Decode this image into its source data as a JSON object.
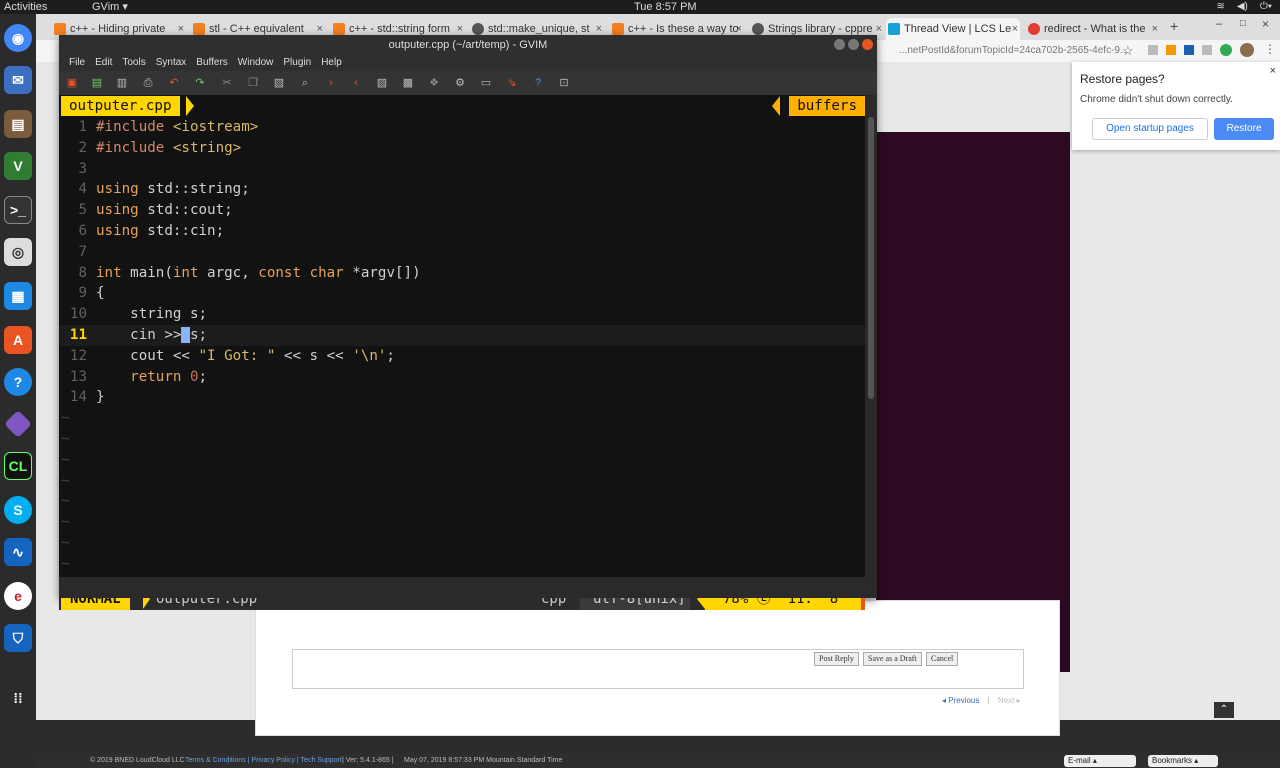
{
  "topbar": {
    "activities": "Activities",
    "app_name": "GVim ▾",
    "clock": "Tue  8:57 PM"
  },
  "chrome": {
    "tabs": [
      {
        "label": "c++ - Hiding private",
        "fav_color": "#f48024"
      },
      {
        "label": "stl - C++ equivalent",
        "fav_color": "#f48024"
      },
      {
        "label": "c++ - std::string form",
        "fav_color": "#f48024"
      },
      {
        "label": "std::make_unique, st",
        "fav_color": "#555555"
      },
      {
        "label": "c++ - Is these a way to",
        "fav_color": "#f48024"
      },
      {
        "label": "Strings library - cppre",
        "fav_color": "#555555"
      },
      {
        "label": "Thread View | LCS Le",
        "fav_color": "#19a0d8"
      },
      {
        "label": "redirect - What is the",
        "fav_color": "#e03c31"
      }
    ],
    "address_fragment": "...netPostId&forumTopicId=24ca702b-2565-4efc-9...",
    "restore": {
      "title": "Restore pages?",
      "message": "Chrome didn't shut down correctly.",
      "startup_button": "Open startup pages",
      "restore_button": "Restore"
    },
    "page": {
      "post_reply": "Post Reply",
      "save_draft": "Save as a Draft",
      "cancel": "Cancel",
      "previous": "◂ Previous",
      "separator": "|",
      "next": "Next ▸"
    },
    "footer": {
      "copyright": "© 2019 BNED LoudCloud LLC",
      "links": "Terms & Conditions | Privacy Policy | Tech Support",
      "version": "| Ver: 5.4.1-865 |",
      "date": "May 07, 2019  8:57:33 PM Mountain Standard Time",
      "email": "E-mail ▴",
      "bookmarks": "Bookmarks ▴"
    }
  },
  "gvim": {
    "title": "outputer.cpp (~/art/temp) - GVIM",
    "menu": [
      "File",
      "Edit",
      "Tools",
      "Syntax",
      "Buffers",
      "Window",
      "Plugin",
      "Help"
    ],
    "tabline": {
      "current": "outputer.cpp",
      "right": "buffers"
    },
    "status": {
      "mode": "NORMAL",
      "file": "outputer.cpp",
      "filetype": "cpp",
      "encoding": "utf-8[unix]",
      "position": "78% Ⓛ  11:  8"
    }
  }
}
